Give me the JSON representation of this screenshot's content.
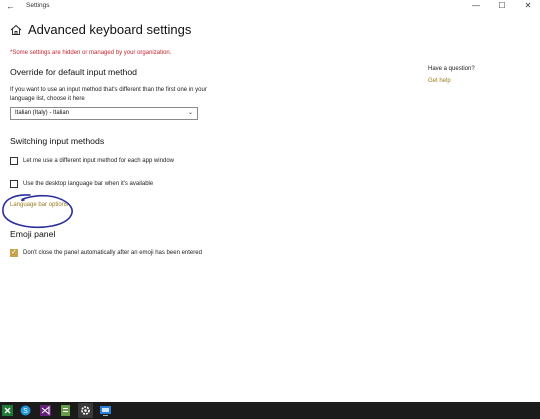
{
  "window": {
    "title": "Settings",
    "controls": {
      "minimize": "—",
      "maximize": "☐",
      "close": "✕"
    }
  },
  "header": {
    "title": "Advanced keyboard settings"
  },
  "org_note": "*Some settings are hidden or managed by your organization.",
  "override": {
    "heading": "Override for default input method",
    "description": "If you want to use an input method that's different than the first one in your language list, choose it here",
    "dropdown_value": "Italian (Italy) - Italian"
  },
  "switching": {
    "heading": "Switching input methods",
    "options": [
      {
        "label": "Let me use a different input method for each app window",
        "checked": false
      },
      {
        "label": "Use the desktop language bar when it's available",
        "checked": false
      }
    ],
    "link": "Language bar options"
  },
  "emoji": {
    "heading": "Emoji panel",
    "option": {
      "label": "Don't close the panel automatically after an emoji has been entered",
      "checked": true
    }
  },
  "help": {
    "title": "Have a question?",
    "link": "Get help"
  },
  "taskbar": {
    "items": [
      "excel-icon",
      "skype-icon",
      "visual-studio-icon",
      "file-icon",
      "settings-icon",
      "remote-desktop-icon"
    ]
  },
  "colors": {
    "accent": "#c8a44a",
    "link": "#9a7d1f",
    "warning": "#c4262e",
    "taskbar": "#1b1b1b"
  }
}
